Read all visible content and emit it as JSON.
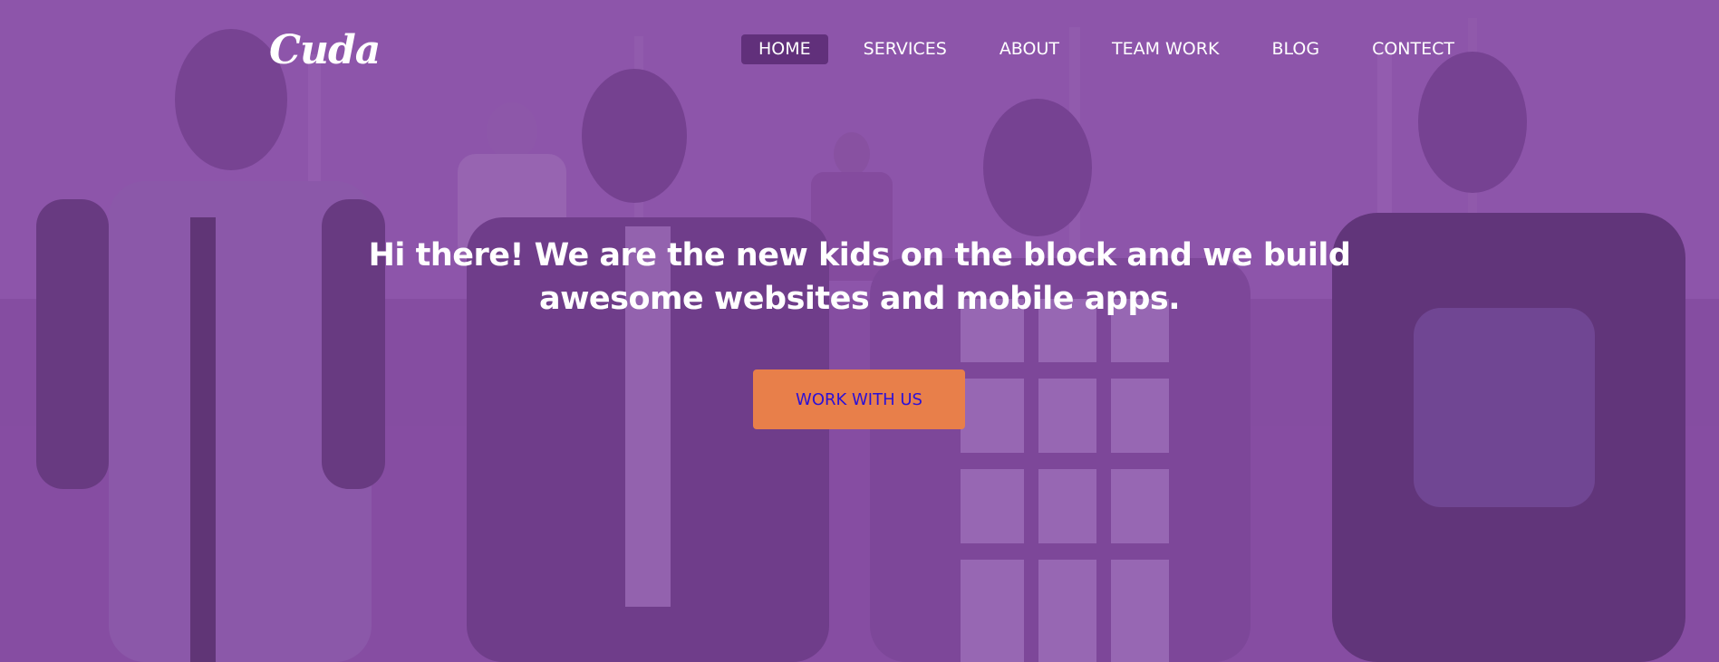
{
  "logo": {
    "text": "Cuda"
  },
  "nav": {
    "items": [
      {
        "label": "HOME",
        "active": true
      },
      {
        "label": "SERVICES",
        "active": false
      },
      {
        "label": "ABOUT",
        "active": false
      },
      {
        "label": "TEAM WORK",
        "active": false
      },
      {
        "label": "BLOG",
        "active": false
      },
      {
        "label": "CONTECT",
        "active": false
      }
    ]
  },
  "hero": {
    "headline_line1": "Hi there! We are the new kids on the block and we build",
    "headline_line2": "awesome websites and mobile apps.",
    "cta_label": "WORK WITH US",
    "background_image": "group-of-four-young-men-walking-photo"
  },
  "colors": {
    "overlay": "#8a55a6",
    "cta_background": "#e87f4a",
    "cta_text": "#2b10d8",
    "nav_active_background": "#5a2a78",
    "text": "#ffffff"
  }
}
